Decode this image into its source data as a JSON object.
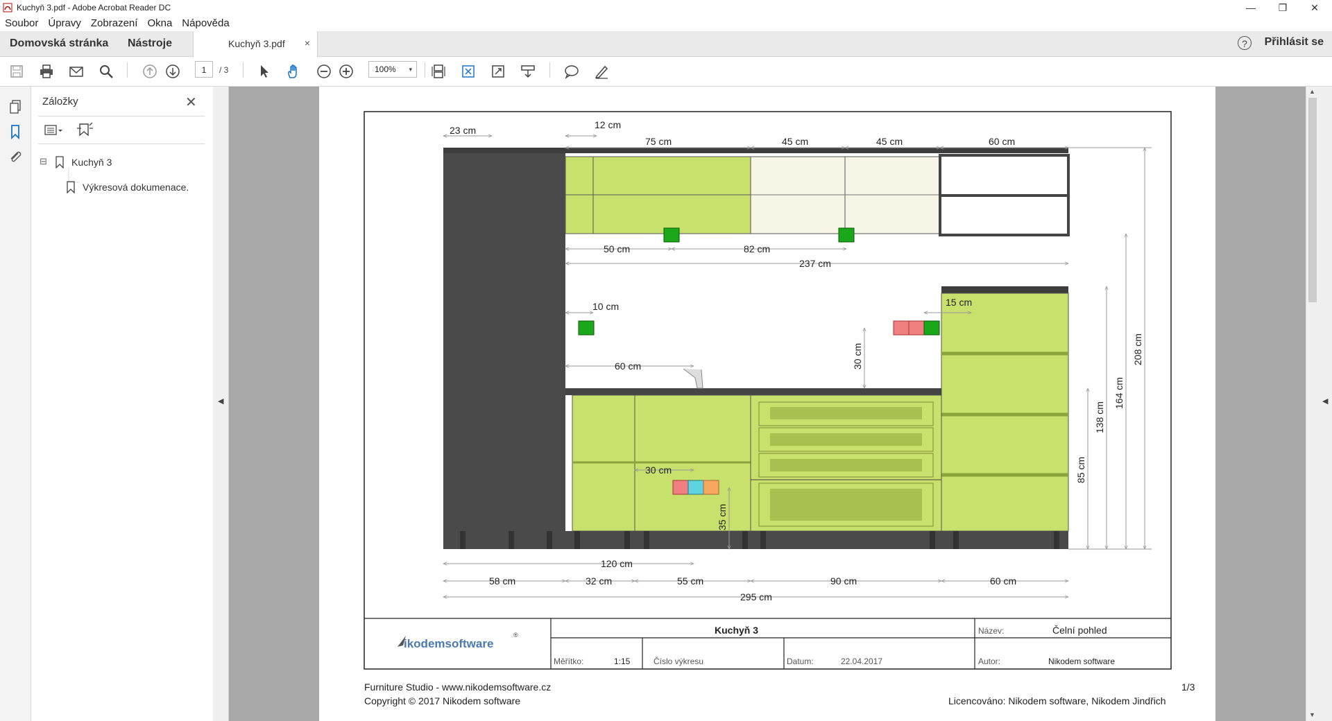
{
  "window": {
    "title": "Kuchyň 3.pdf - Adobe Acrobat Reader DC",
    "minimize": "—",
    "restore": "❐",
    "close": "✕"
  },
  "menu": [
    "Soubor",
    "Úpravy",
    "Zobrazení",
    "Okna",
    "Nápověda"
  ],
  "tabs": {
    "home": "Domovská stránka",
    "tools": "Nástroje",
    "document": "Kuchyň 3.pdf",
    "close": "×",
    "help": "?",
    "signin": "Přihlásit se"
  },
  "toolbar": {
    "page_current": "1",
    "page_total": "/ 3",
    "zoom": "100%",
    "zoom_arrow": "▾",
    "icons": [
      "save-icon",
      "print-icon",
      "email-icon",
      "search-icon",
      "prev-page-icon",
      "next-page-icon",
      "select-icon",
      "hand-icon",
      "zoom-out-icon",
      "zoom-in-icon",
      "scroll-mode-icon",
      "fit-page-icon",
      "full-screen-icon",
      "page-display-icon",
      "comment-icon",
      "sign-icon"
    ]
  },
  "bookmarks": {
    "header": "Záložky",
    "close": "✕",
    "items": [
      {
        "label": "Kuchyň 3",
        "toggle": "⊟"
      },
      {
        "label": "Výkresová dokumenace."
      }
    ]
  },
  "drawing": {
    "dims": {
      "d23": "23 cm",
      "d12": "12 cm",
      "d75": "75 cm",
      "d45a": "45 cm",
      "d45b": "45 cm",
      "d60top": "60 cm",
      "d50": "50 cm",
      "d82": "82 cm",
      "d237": "237 cm",
      "d10": "10 cm",
      "d15": "15 cm",
      "d60sink": "60 cm",
      "d30v": "30 cm",
      "d30h": "30 cm",
      "d35": "35 cm",
      "d120": "120 cm",
      "d58": "58 cm",
      "d32": "32 cm",
      "d55": "55 cm",
      "d90": "90 cm",
      "d60bot": "60 cm",
      "d295": "295 cm",
      "d85": "85 cm",
      "d138": "138 cm",
      "d164": "164 cm",
      "d208": "208 cm"
    },
    "titleblock": {
      "logo_name": "ikodemsoftware",
      "logo_mark": "®",
      "name_main": "Kuchyň 3",
      "label_name": "Název:",
      "value_name": "Čelní pohled",
      "label_scale": "Měřítko:",
      "value_scale": "1:15",
      "label_number": "Číslo výkresu",
      "label_date": "Datum:",
      "value_date": "22.04.2017",
      "label_author": "Autor:",
      "value_author": "Nikodem software"
    }
  },
  "footer": {
    "studio": "Furniture Studio - www.nikodemsoftware.cz",
    "copyright": "Copyright © 2017 Nikodem software",
    "page": "1/3",
    "license": "Licencováno:  Nikodem software, Nikodem Jindřich"
  },
  "colors": {
    "cabinet_green": "#c8e06c",
    "dark_panel": "#4a4a4a",
    "marker_green": "#1aa81a",
    "socket_red": "#f08080",
    "socket_cyan": "#5fd3e0",
    "socket_orange": "#f5a860"
  }
}
